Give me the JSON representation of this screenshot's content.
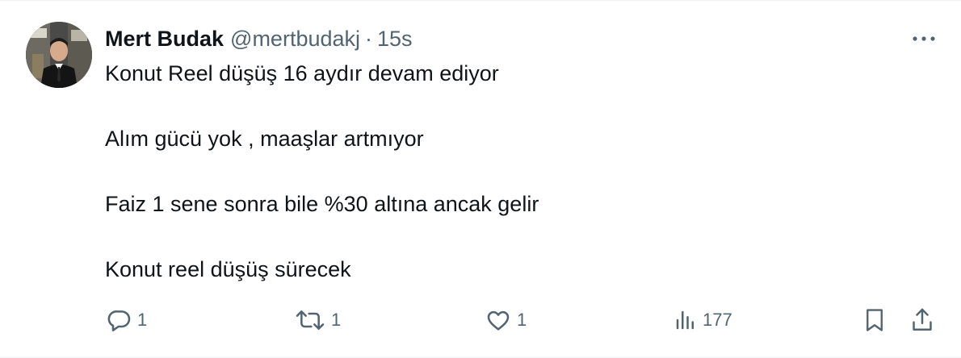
{
  "author": {
    "name": "Mert Budak",
    "handle": "@mertbudakj",
    "separator": "·",
    "time": "15s"
  },
  "tweet": {
    "lines": [
      "Konut Reel düşüş 16 aydır devam ediyor",
      "Alım gücü yok , maaşlar artmıyor",
      "Faiz 1 sene sonra bile %30 altına ancak gelir",
      "Konut reel düşüş sürecek"
    ]
  },
  "actions": {
    "replies": "1",
    "retweets": "1",
    "likes": "1",
    "views": "177"
  },
  "colors": {
    "text": "#0f1419",
    "secondary": "#536471",
    "border": "#eff3f4"
  },
  "icons": [
    "more-icon",
    "reply-icon",
    "retweet-icon",
    "like-icon",
    "views-icon",
    "bookmark-icon",
    "share-icon"
  ]
}
